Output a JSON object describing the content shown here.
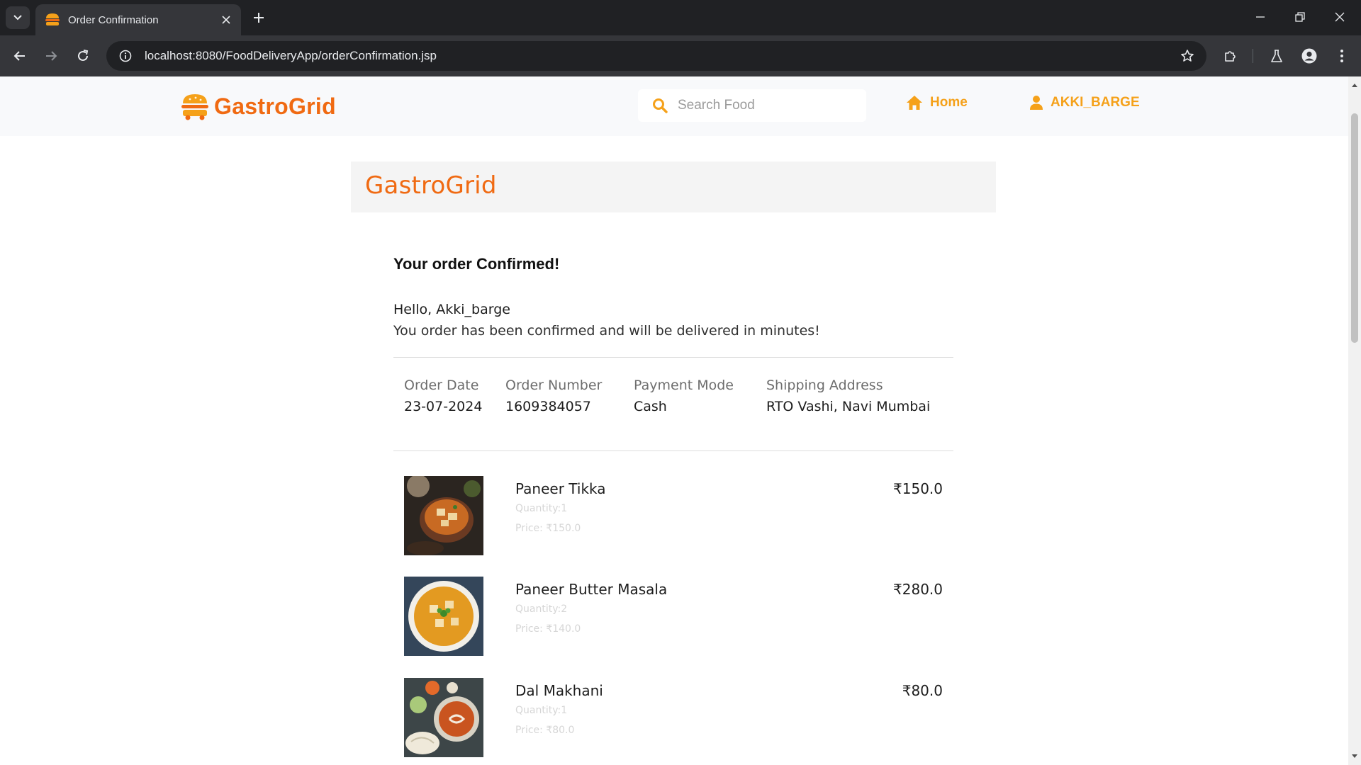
{
  "browser": {
    "tab_title": "Order Confirmation",
    "url": "localhost:8080/FoodDeliveryApp/orderConfirmation.jsp"
  },
  "header": {
    "brand": "GastroGrid",
    "search_placeholder": "Search Food",
    "nav_home": "Home",
    "nav_user": "AKKI_BARGE"
  },
  "card": {
    "banner_title": "GastroGrid",
    "heading": "Your order Confirmed!",
    "greeting": "Hello, Akki_barge",
    "message": "You order has been confirmed and will be delivered in minutes!",
    "info": [
      {
        "label": "Order Date",
        "value": "23-07-2024"
      },
      {
        "label": "Order Number",
        "value": "1609384057"
      },
      {
        "label": "Payment Mode",
        "value": "Cash"
      },
      {
        "label": "Shipping Address",
        "value": "RTO Vashi, Navi Mumbai"
      }
    ],
    "items": [
      {
        "name": "Paneer Tikka",
        "quantity": "Quantity:1",
        "price": "Price: ₹150.0",
        "total": "₹150.0"
      },
      {
        "name": "Paneer Butter Masala",
        "quantity": "Quantity:2",
        "price": "Price: ₹140.0",
        "total": "₹280.0"
      },
      {
        "name": "Dal Makhani",
        "quantity": "Quantity:1",
        "price": "Price: ₹80.0",
        "total": "₹80.0"
      }
    ]
  },
  "colors": {
    "brand_orange": "#f06a12",
    "nav_amber": "#f5a11a",
    "chrome_dark": "#202124",
    "chrome_toolbar": "#35363a"
  },
  "icons": {
    "tab_search": "chevron-down-icon",
    "favicon": "burger-icon",
    "tab_close": "close-icon",
    "new_tab": "plus-icon",
    "back": "arrow-left-icon",
    "forward": "arrow-right-icon",
    "reload": "reload-icon",
    "site_info": "info-icon",
    "bookmark": "star-icon",
    "extensions": "puzzle-icon",
    "labs": "flask-icon",
    "profile": "person-icon",
    "menu": "kebab-menu-icon",
    "search": "search-icon",
    "home": "home-icon",
    "user": "user-icon"
  }
}
